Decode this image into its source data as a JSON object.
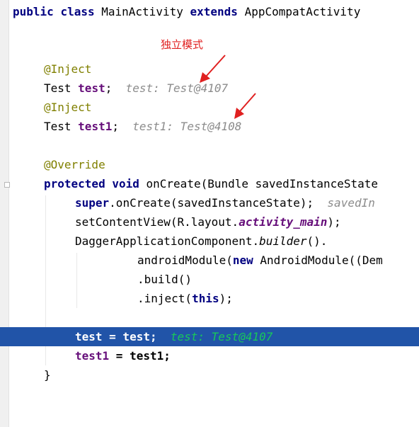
{
  "annotation": {
    "label": "独立模式",
    "color": "#e02020"
  },
  "colors": {
    "keyword": "#000080",
    "annotation": "#808000",
    "field": "#660e7a",
    "hint": "#8c8c8c",
    "selection_bg": "#2154a8",
    "selection_hint": "#18c85a",
    "arrow": "#e02020"
  },
  "code": {
    "l1": {
      "kw_public": "public",
      "kw_class": "class",
      "classname": "MainActivity",
      "kw_extends": "extends",
      "parent": "AppCompatActivity"
    },
    "l2": {
      "annotation": "@Inject"
    },
    "l3": {
      "type": "Test",
      "field": "test",
      "semi": ";",
      "hint": "test: Test@4107"
    },
    "l4": {
      "annotation": "@Inject"
    },
    "l5": {
      "type": "Test",
      "field": "test1",
      "semi": ";",
      "hint": "test1: Test@4108"
    },
    "l6": {
      "annotation": "@Override"
    },
    "l7": {
      "kw_protected": "protected",
      "kw_void": "void",
      "rest": "onCreate(Bundle savedInstanceState"
    },
    "l8": {
      "kw_super": "super",
      "rest": ".onCreate(savedInstanceState);",
      "hint": "savedIn"
    },
    "l9": {
      "pre": "setContentView(R.layout.",
      "field": "activity_main",
      "post": ");"
    },
    "l10": {
      "pre": "DaggerApplicationComponent.",
      "method": "builder",
      "post": "()."
    },
    "l11": {
      "pre": "androidModule(",
      "kw_new": "new",
      "post": "AndroidModule((Dem"
    },
    "l12": {
      "text": ".build()"
    },
    "l13": {
      "pre": ".inject(",
      "kw_this": "this",
      "post": ");"
    },
    "l14": {
      "field_a": "test",
      "mid": " = test;",
      "hint": "test: Test@4107"
    },
    "l15": {
      "field_a": "test1",
      "mid": " = test1;"
    },
    "l16": {
      "text": "}"
    }
  }
}
